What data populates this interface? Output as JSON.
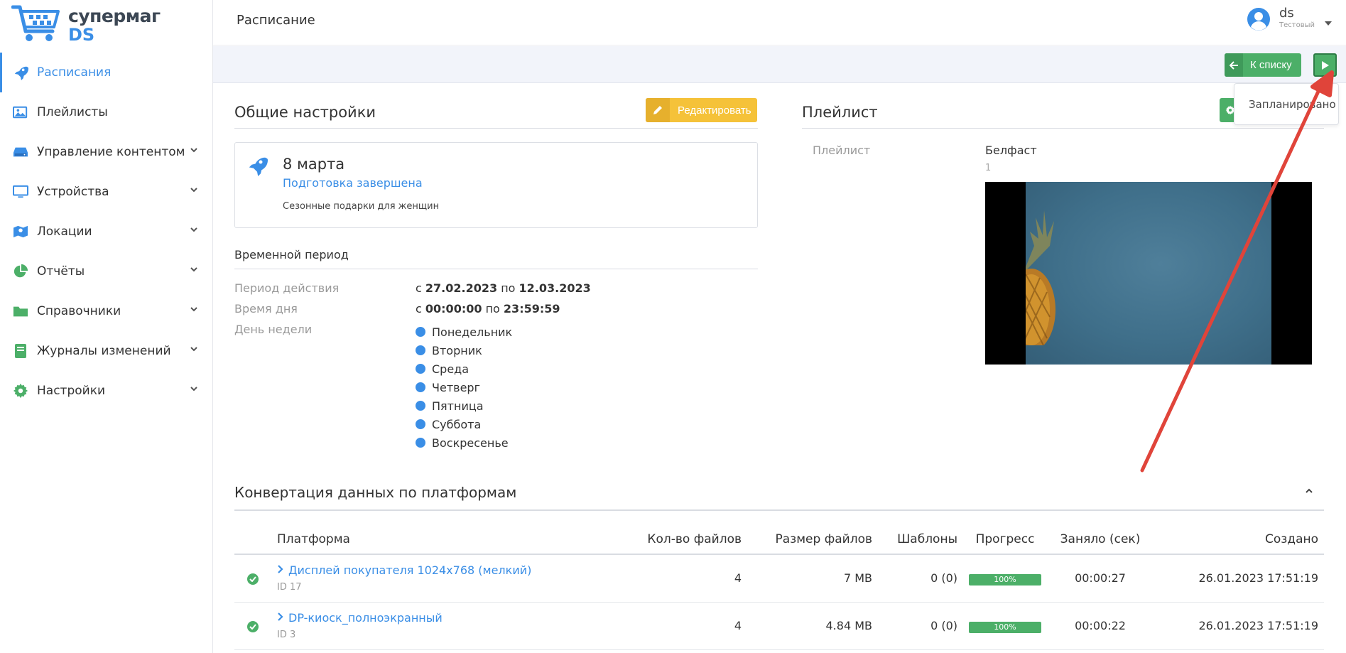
{
  "logo": {
    "line1": "супермаг",
    "line2": "DS"
  },
  "sidebar": {
    "items": [
      {
        "label": "Расписания",
        "icon": "rocket-icon",
        "active": true,
        "has_submenu": false
      },
      {
        "label": "Плейлисты",
        "icon": "images-icon",
        "active": false,
        "has_submenu": false
      },
      {
        "label": "Управление контентом",
        "icon": "hdd-icon",
        "active": false,
        "has_submenu": true
      },
      {
        "label": "Устройства",
        "icon": "monitor-icon",
        "active": false,
        "has_submenu": true
      },
      {
        "label": "Локации",
        "icon": "map-icon",
        "active": false,
        "has_submenu": true
      },
      {
        "label": "Отчёты",
        "icon": "pie-chart-icon",
        "active": false,
        "has_submenu": true
      },
      {
        "label": "Справочники",
        "icon": "folder-icon",
        "active": false,
        "has_submenu": true
      },
      {
        "label": "Журналы изменений",
        "icon": "book-icon",
        "active": false,
        "has_submenu": true
      },
      {
        "label": "Настройки",
        "icon": "gear-icon",
        "active": false,
        "has_submenu": true
      }
    ]
  },
  "header": {
    "title": "Расписание",
    "user": {
      "name": "ds",
      "role": "Тестовый"
    }
  },
  "toolbar": {
    "back_label": "К списку",
    "play_tooltip": "Запланировано"
  },
  "general": {
    "title": "Общие настройки",
    "edit_label": "Редактировать",
    "card": {
      "name": "8 марта",
      "status": "Подготовка завершена",
      "description": "Сезонные подарки для женщин"
    },
    "period": {
      "title": "Временной период",
      "validity_label": "Период действия",
      "validity_from_prefix": "с",
      "validity_from": "27.02.2023",
      "validity_to_prefix": "по",
      "validity_to": "12.03.2023",
      "time_label": "Время дня",
      "time_from": "00:00:00",
      "time_to": "23:59:59",
      "weekday_label": "День недели",
      "weekdays": [
        "Понедельник",
        "Вторник",
        "Среда",
        "Четверг",
        "Пятница",
        "Суббота",
        "Воскресенье"
      ]
    }
  },
  "playlist": {
    "title": "Плейлист",
    "label": "Плейлист",
    "name": "Белфаст",
    "count": "1"
  },
  "conversion": {
    "title": "Конвертация данных по платформам",
    "columns": [
      "Платформа",
      "Кол-во файлов",
      "Размер файлов",
      "Шаблоны",
      "Прогресс",
      "Заняло (сек)",
      "Создано"
    ],
    "rows": [
      {
        "platform": "Дисплей покупателя 1024x768 (мелкий)",
        "id": "ID 17",
        "files": "4",
        "size": "7 MB",
        "templates": "0 (0)",
        "progress": "100%",
        "elapsed": "00:00:27",
        "created": "26.01.2023 17:51:19"
      },
      {
        "platform": "DP-киоск_полноэкранный",
        "id": "ID 3",
        "files": "4",
        "size": "4.84 MB",
        "templates": "0 (0)",
        "progress": "100%",
        "elapsed": "00:00:22",
        "created": "26.01.2023 17:51:19"
      }
    ]
  },
  "colors": {
    "accent": "#3a8ee6",
    "success": "#4caf68",
    "warning": "#f5c239",
    "annotation_arrow": "#e0443a"
  }
}
